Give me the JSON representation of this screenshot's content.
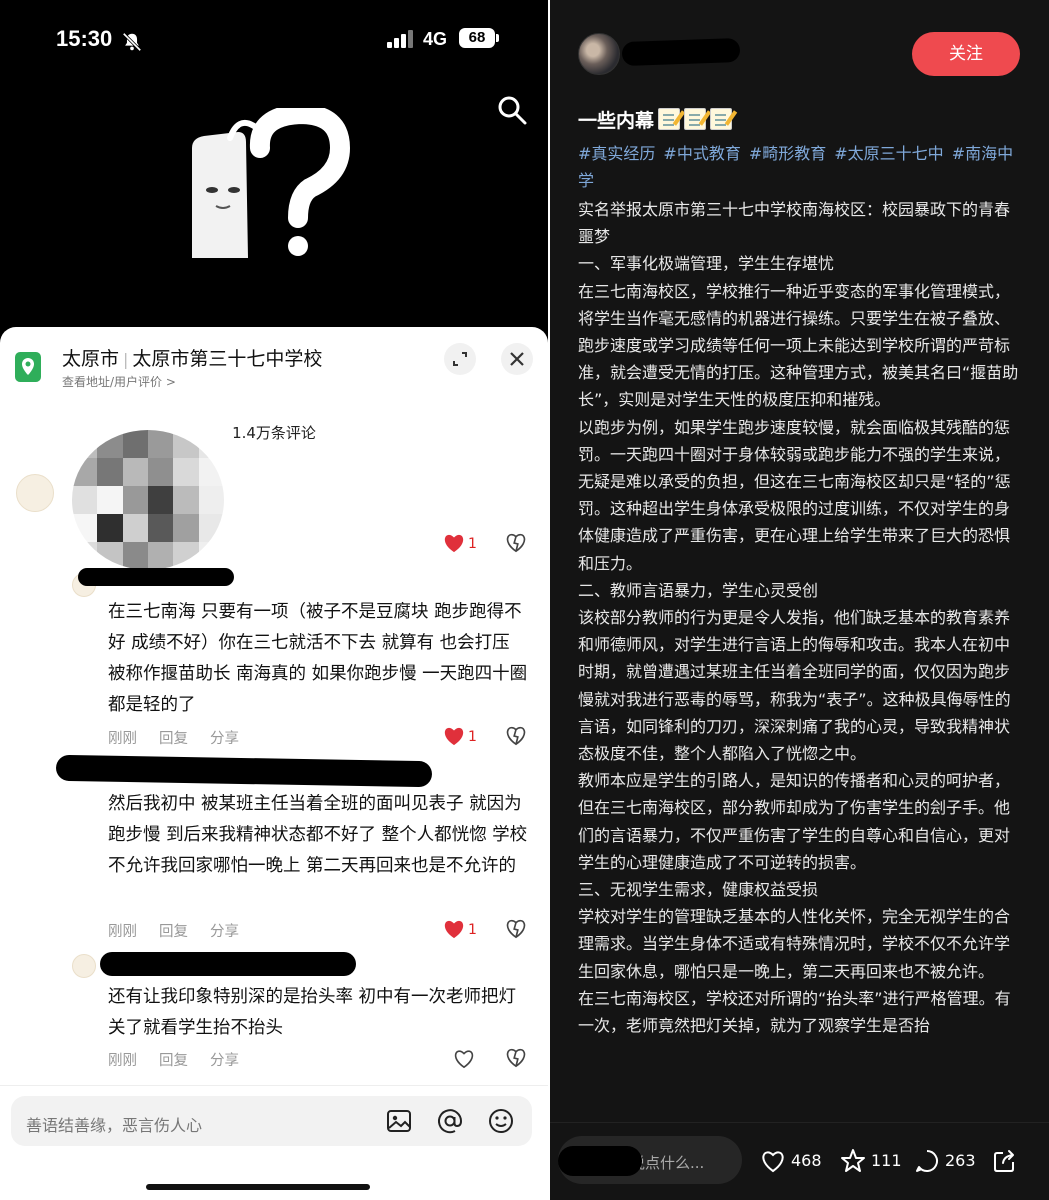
{
  "status_bar": {
    "time": "15:30",
    "network": "4G",
    "battery": "68"
  },
  "location": {
    "city": "太原市",
    "name": "太原市第三十七中学校",
    "sub": "查看地址/用户评价 >"
  },
  "comment_count": "1.4万条评论",
  "comments": [
    {
      "likes": "1",
      "text": "在三七南海 只要有一项（被子不是豆腐块 跑步跑得不好 成绩不好）你在三七就活不下去 就算有 也会打压 被称作揠苗助长 南海真的 如果你跑步慢 一天跑四十圈都是轻的了",
      "time": "刚刚",
      "reply": "回复",
      "share": "分享",
      "comment_likes": "1"
    },
    {
      "text": "然后我初中 被某班主任当着全班的面叫见表子 就因为跑步慢 到后来我精神状态都不好了 整个人都恍惚 学校不允许我回家哪怕一晚上 第二天再回来也是不允许的",
      "time": "刚刚",
      "reply": "回复",
      "share": "分享",
      "likes": "1"
    },
    {
      "text": "还有让我印象特别深的是抬头率 初中有一次老师把灯关了就看学生抬不抬头",
      "time": "刚刚",
      "reply": "回复",
      "share": "分享"
    }
  ],
  "input_placeholder": "善语结善缘，恶言伤人心",
  "post": {
    "follow_label": "关注",
    "title": "一些内幕",
    "tags": [
      "#真实经历",
      "#中式教育",
      "#畸形教育",
      "#太原三十七中",
      "#南海中学"
    ],
    "paragraphs": [
      "实名举报太原市第三十七中学校南海校区：校园暴政下的青春噩梦",
      "一、军事化极端管理，学生生存堪忧",
      "在三七南海校区，学校推行一种近乎变态的军事化管理模式，将学生当作毫无感情的机器进行操练。只要学生在被子叠放、跑步速度或学习成绩等任何一项上未能达到学校所谓的严苛标准，就会遭受无情的打压。这种管理方式，被美其名曰“揠苗助长”，实则是对学生天性的极度压抑和摧残。",
      "以跑步为例，如果学生跑步速度较慢，就会面临极其残酷的惩罚。一天跑四十圈对于身体较弱或跑步能力不强的学生来说，无疑是难以承受的负担，但这在三七南海校区却只是“轻的”惩罚。这种超出学生身体承受极限的过度训练，不仅对学生的身体健康造成了严重伤害，更在心理上给学生带来了巨大的恐惧和压力。",
      "二、教师言语暴力，学生心灵受创",
      "该校部分教师的行为更是令人发指，他们缺乏基本的教育素养和师德师风，对学生进行言语上的侮辱和攻击。我本人在初中时期，就曾遭遇过某班主任当着全班同学的面，仅仅因为跑步慢就对我进行恶毒的辱骂，称我为“表子”。这种极具侮辱性的言语，如同锋利的刀刃，深深刺痛了我的心灵，导致我精神状态极度不佳，整个人都陷入了恍惚之中。",
      "教师本应是学生的引路人，是知识的传播者和心灵的呵护者，但在三七南海校区，部分教师却成为了伤害学生的刽子手。他们的言语暴力，不仅严重伤害了学生的自尊心和自信心，更对学生的心理健康造成了不可逆转的损害。",
      "三、无视学生需求，健康权益受损",
      "学校对学生的管理缺乏基本的人性化关怀，完全无视学生的合理需求。当学生身体不适或有特殊情况时，学校不仅不允许学生回家休息，哪怕只是一晚上，第二天再回来也不被允许。",
      "在三七南海校区，学校还对所谓的“抬头率”进行严格管理。有一次，老师竟然把灯关掉，就为了观察学生是否抬"
    ],
    "comment_placeholder": "说点什么...",
    "likes": "468",
    "favorites": "111",
    "comments": "263"
  }
}
